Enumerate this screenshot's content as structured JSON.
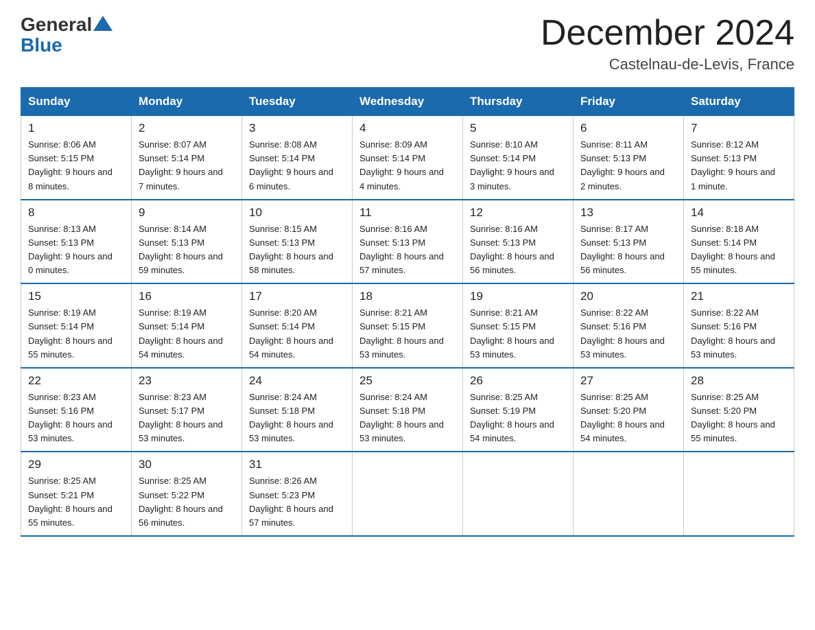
{
  "header": {
    "logo_general": "General",
    "logo_blue": "Blue",
    "title": "December 2024",
    "location": "Castelnau-de-Levis, France"
  },
  "weekdays": [
    "Sunday",
    "Monday",
    "Tuesday",
    "Wednesday",
    "Thursday",
    "Friday",
    "Saturday"
  ],
  "weeks": [
    [
      {
        "day": "1",
        "sunrise": "8:06 AM",
        "sunset": "5:15 PM",
        "daylight": "9 hours and 8 minutes."
      },
      {
        "day": "2",
        "sunrise": "8:07 AM",
        "sunset": "5:14 PM",
        "daylight": "9 hours and 7 minutes."
      },
      {
        "day": "3",
        "sunrise": "8:08 AM",
        "sunset": "5:14 PM",
        "daylight": "9 hours and 6 minutes."
      },
      {
        "day": "4",
        "sunrise": "8:09 AM",
        "sunset": "5:14 PM",
        "daylight": "9 hours and 4 minutes."
      },
      {
        "day": "5",
        "sunrise": "8:10 AM",
        "sunset": "5:14 PM",
        "daylight": "9 hours and 3 minutes."
      },
      {
        "day": "6",
        "sunrise": "8:11 AM",
        "sunset": "5:13 PM",
        "daylight": "9 hours and 2 minutes."
      },
      {
        "day": "7",
        "sunrise": "8:12 AM",
        "sunset": "5:13 PM",
        "daylight": "9 hours and 1 minute."
      }
    ],
    [
      {
        "day": "8",
        "sunrise": "8:13 AM",
        "sunset": "5:13 PM",
        "daylight": "9 hours and 0 minutes."
      },
      {
        "day": "9",
        "sunrise": "8:14 AM",
        "sunset": "5:13 PM",
        "daylight": "8 hours and 59 minutes."
      },
      {
        "day": "10",
        "sunrise": "8:15 AM",
        "sunset": "5:13 PM",
        "daylight": "8 hours and 58 minutes."
      },
      {
        "day": "11",
        "sunrise": "8:16 AM",
        "sunset": "5:13 PM",
        "daylight": "8 hours and 57 minutes."
      },
      {
        "day": "12",
        "sunrise": "8:16 AM",
        "sunset": "5:13 PM",
        "daylight": "8 hours and 56 minutes."
      },
      {
        "day": "13",
        "sunrise": "8:17 AM",
        "sunset": "5:13 PM",
        "daylight": "8 hours and 56 minutes."
      },
      {
        "day": "14",
        "sunrise": "8:18 AM",
        "sunset": "5:14 PM",
        "daylight": "8 hours and 55 minutes."
      }
    ],
    [
      {
        "day": "15",
        "sunrise": "8:19 AM",
        "sunset": "5:14 PM",
        "daylight": "8 hours and 55 minutes."
      },
      {
        "day": "16",
        "sunrise": "8:19 AM",
        "sunset": "5:14 PM",
        "daylight": "8 hours and 54 minutes."
      },
      {
        "day": "17",
        "sunrise": "8:20 AM",
        "sunset": "5:14 PM",
        "daylight": "8 hours and 54 minutes."
      },
      {
        "day": "18",
        "sunrise": "8:21 AM",
        "sunset": "5:15 PM",
        "daylight": "8 hours and 53 minutes."
      },
      {
        "day": "19",
        "sunrise": "8:21 AM",
        "sunset": "5:15 PM",
        "daylight": "8 hours and 53 minutes."
      },
      {
        "day": "20",
        "sunrise": "8:22 AM",
        "sunset": "5:16 PM",
        "daylight": "8 hours and 53 minutes."
      },
      {
        "day": "21",
        "sunrise": "8:22 AM",
        "sunset": "5:16 PM",
        "daylight": "8 hours and 53 minutes."
      }
    ],
    [
      {
        "day": "22",
        "sunrise": "8:23 AM",
        "sunset": "5:16 PM",
        "daylight": "8 hours and 53 minutes."
      },
      {
        "day": "23",
        "sunrise": "8:23 AM",
        "sunset": "5:17 PM",
        "daylight": "8 hours and 53 minutes."
      },
      {
        "day": "24",
        "sunrise": "8:24 AM",
        "sunset": "5:18 PM",
        "daylight": "8 hours and 53 minutes."
      },
      {
        "day": "25",
        "sunrise": "8:24 AM",
        "sunset": "5:18 PM",
        "daylight": "8 hours and 53 minutes."
      },
      {
        "day": "26",
        "sunrise": "8:25 AM",
        "sunset": "5:19 PM",
        "daylight": "8 hours and 54 minutes."
      },
      {
        "day": "27",
        "sunrise": "8:25 AM",
        "sunset": "5:20 PM",
        "daylight": "8 hours and 54 minutes."
      },
      {
        "day": "28",
        "sunrise": "8:25 AM",
        "sunset": "5:20 PM",
        "daylight": "8 hours and 55 minutes."
      }
    ],
    [
      {
        "day": "29",
        "sunrise": "8:25 AM",
        "sunset": "5:21 PM",
        "daylight": "8 hours and 55 minutes."
      },
      {
        "day": "30",
        "sunrise": "8:25 AM",
        "sunset": "5:22 PM",
        "daylight": "8 hours and 56 minutes."
      },
      {
        "day": "31",
        "sunrise": "8:26 AM",
        "sunset": "5:23 PM",
        "daylight": "8 hours and 57 minutes."
      },
      null,
      null,
      null,
      null
    ]
  ]
}
